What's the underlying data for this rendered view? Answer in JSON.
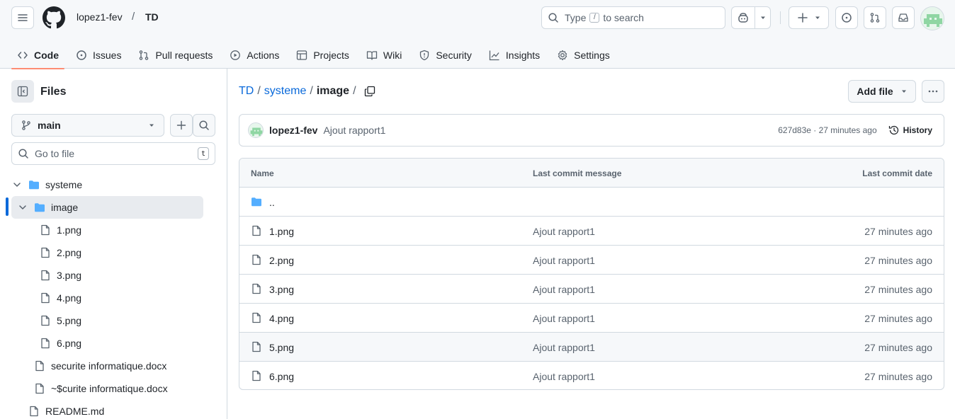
{
  "header": {
    "owner": "lopez1-fev",
    "separator": "/",
    "repo": "TD",
    "search": {
      "prefix": "Type",
      "key": "/",
      "suffix": "to search"
    }
  },
  "tabs": [
    {
      "label": "Code",
      "icon": "code-icon",
      "active": true
    },
    {
      "label": "Issues",
      "icon": "issue-icon"
    },
    {
      "label": "Pull requests",
      "icon": "pull-request-icon"
    },
    {
      "label": "Actions",
      "icon": "play-icon"
    },
    {
      "label": "Projects",
      "icon": "table-icon"
    },
    {
      "label": "Wiki",
      "icon": "book-icon"
    },
    {
      "label": "Security",
      "icon": "shield-icon"
    },
    {
      "label": "Insights",
      "icon": "graph-icon"
    },
    {
      "label": "Settings",
      "icon": "gear-icon"
    }
  ],
  "sidebar": {
    "title": "Files",
    "branch": "main",
    "go_to_file": "Go to file",
    "go_to_file_key": "t",
    "tree": [
      {
        "label": "systeme",
        "type": "folder",
        "expanded": true
      },
      {
        "label": "image",
        "type": "folder",
        "expanded": true,
        "selected": true
      },
      {
        "label": "1.png",
        "type": "file"
      },
      {
        "label": "2.png",
        "type": "file"
      },
      {
        "label": "3.png",
        "type": "file"
      },
      {
        "label": "4.png",
        "type": "file"
      },
      {
        "label": "5.png",
        "type": "file"
      },
      {
        "label": "6.png",
        "type": "file"
      },
      {
        "label": "securite informatique.docx",
        "type": "file"
      },
      {
        "label": "~$curite informatique.docx",
        "type": "file"
      },
      {
        "label": "README.md",
        "type": "file"
      }
    ]
  },
  "main": {
    "path": {
      "root": "TD",
      "folder": "systeme",
      "current": "image",
      "sep": "/"
    },
    "add_file": "Add file",
    "commit": {
      "author": "lopez1-fev",
      "message": "Ajout rapport1",
      "meta": "627d83e · 27 minutes ago",
      "history": "History"
    },
    "table": {
      "headers": {
        "name": "Name",
        "message": "Last commit message",
        "date": "Last commit date"
      },
      "parent": "..",
      "rows": [
        {
          "name": "1.png",
          "message": "Ajout rapport1",
          "date": "27 minutes ago"
        },
        {
          "name": "2.png",
          "message": "Ajout rapport1",
          "date": "27 minutes ago"
        },
        {
          "name": "3.png",
          "message": "Ajout rapport1",
          "date": "27 minutes ago"
        },
        {
          "name": "4.png",
          "message": "Ajout rapport1",
          "date": "27 minutes ago"
        },
        {
          "name": "5.png",
          "message": "Ajout rapport1",
          "date": "27 minutes ago"
        },
        {
          "name": "6.png",
          "message": "Ajout rapport1",
          "date": "27 minutes ago"
        }
      ]
    }
  },
  "colors": {
    "accent": "#0969da",
    "folder": "#54aeff",
    "tab_underline": "#fd8c73",
    "avatar": "#8fd6a3"
  }
}
